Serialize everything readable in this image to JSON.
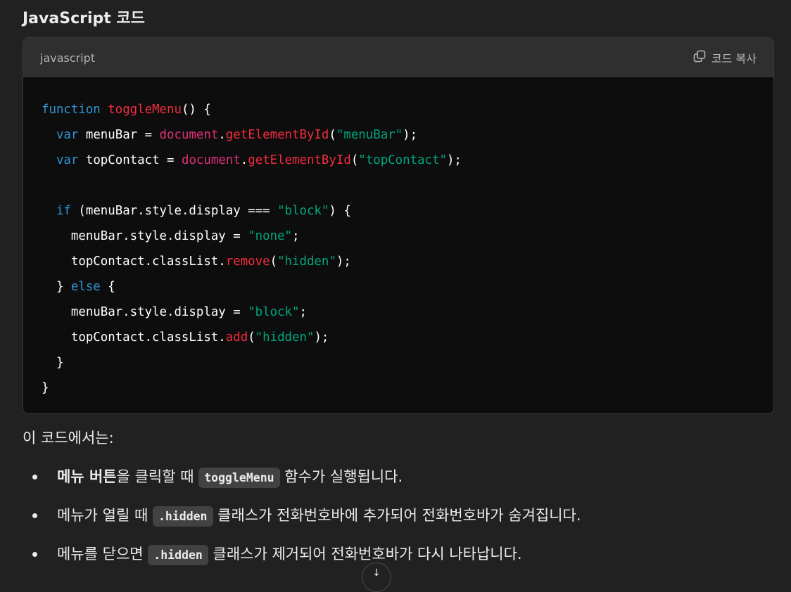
{
  "heading": "JavaScript 코드",
  "code_block": {
    "language": "javascript",
    "copy_label": "코드 복사",
    "lines": [
      [
        {
          "t": "function",
          "c": "kw"
        },
        {
          "t": " "
        },
        {
          "t": "toggleMenu",
          "c": "fn"
        },
        {
          "t": "() {"
        }
      ],
      [
        {
          "t": "  "
        },
        {
          "t": "var",
          "c": "kw"
        },
        {
          "t": " menuBar = "
        },
        {
          "t": "document",
          "c": "obj"
        },
        {
          "t": "."
        },
        {
          "t": "getElementById",
          "c": "fn"
        },
        {
          "t": "("
        },
        {
          "t": "\"menuBar\"",
          "c": "str"
        },
        {
          "t": ");"
        }
      ],
      [
        {
          "t": "  "
        },
        {
          "t": "var",
          "c": "kw"
        },
        {
          "t": " topContact = "
        },
        {
          "t": "document",
          "c": "obj"
        },
        {
          "t": "."
        },
        {
          "t": "getElementById",
          "c": "fn"
        },
        {
          "t": "("
        },
        {
          "t": "\"topContact\"",
          "c": "str"
        },
        {
          "t": ");"
        }
      ],
      [],
      [
        {
          "t": "  "
        },
        {
          "t": "if",
          "c": "kw"
        },
        {
          "t": " (menuBar.style.display === "
        },
        {
          "t": "\"block\"",
          "c": "str"
        },
        {
          "t": ") {"
        }
      ],
      [
        {
          "t": "    menuBar.style.display = "
        },
        {
          "t": "\"none\"",
          "c": "str"
        },
        {
          "t": ";"
        }
      ],
      [
        {
          "t": "    topContact.classList."
        },
        {
          "t": "remove",
          "c": "fn"
        },
        {
          "t": "("
        },
        {
          "t": "\"hidden\"",
          "c": "str"
        },
        {
          "t": ");"
        }
      ],
      [
        {
          "t": "  } "
        },
        {
          "t": "else",
          "c": "kw"
        },
        {
          "t": " {"
        }
      ],
      [
        {
          "t": "    menuBar.style.display = "
        },
        {
          "t": "\"block\"",
          "c": "str"
        },
        {
          "t": ";"
        }
      ],
      [
        {
          "t": "    topContact.classList."
        },
        {
          "t": "add",
          "c": "fn"
        },
        {
          "t": "("
        },
        {
          "t": "\"hidden\"",
          "c": "str"
        },
        {
          "t": ");"
        }
      ],
      [
        {
          "t": "  }"
        }
      ],
      [
        {
          "t": "}"
        }
      ]
    ]
  },
  "intro": "이 코드에서는:",
  "points": [
    {
      "bold": "메뉴 버튼",
      "pre": "을 클릭할 때 ",
      "code": "toggleMenu",
      "post": " 함수가 실행됩니다."
    },
    {
      "bold": "",
      "pre": "메뉴가 열릴 때 ",
      "code": ".hidden",
      "post": " 클래스가 전화번호바에 추가되어 전화번호바가 숨겨집니다."
    },
    {
      "bold": "",
      "pre": "메뉴를 닫으면 ",
      "code": ".hidden",
      "post": " 클래스가 제거되어 전화번호바가 다시 나타납니다."
    }
  ],
  "icons": {
    "copy": "copy-icon",
    "scroll": "arrow-down-icon"
  },
  "colors": {
    "background": "#212121",
    "code_bg": "#0d0d0d",
    "keyword": "#2e95d3",
    "function": "#f22c3d",
    "object": "#df3079",
    "string": "#00a67d"
  }
}
